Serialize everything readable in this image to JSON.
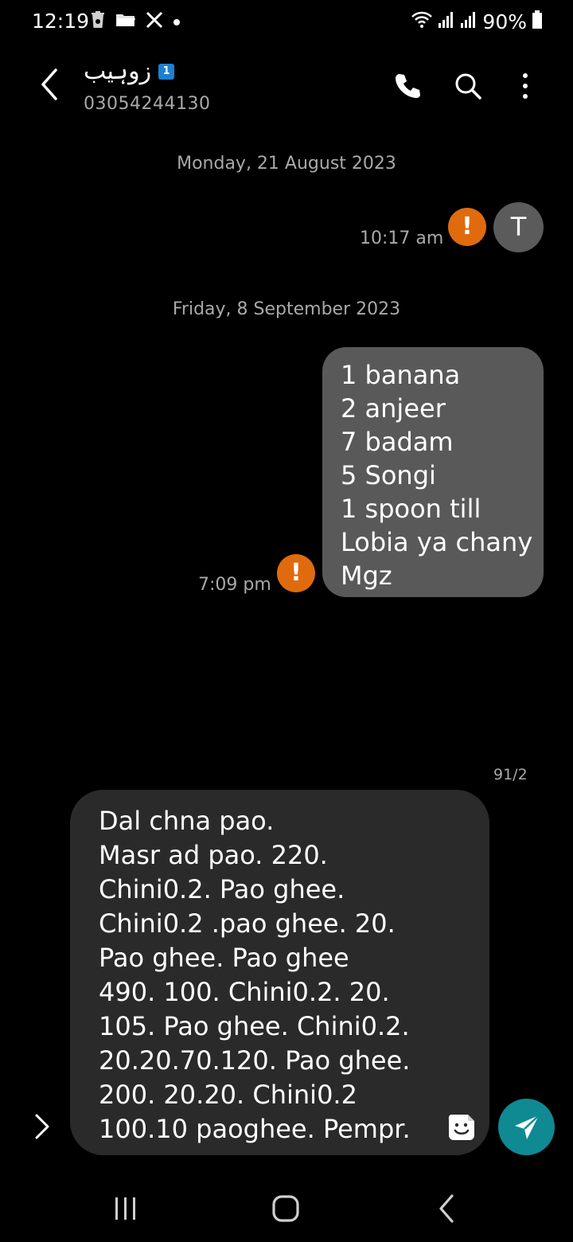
{
  "status_bar": {
    "time": "12:19",
    "notification_icons": [
      "recycle-bin-icon",
      "folder-icon",
      "x-logo-icon",
      "dot-icon"
    ],
    "battery": "90%"
  },
  "header": {
    "contact_name": "زوہیب",
    "sim_badge": "1",
    "contact_number": "03054244130"
  },
  "conversation": {
    "date_1": "Monday, 21 August 2023",
    "message_1": {
      "time": "10:17 am",
      "avatar_letter": "T",
      "status": "!"
    },
    "date_2": "Friday, 8 September 2023",
    "message_2": {
      "time": "7:09 pm",
      "status": "!",
      "lines": [
        "1 banana",
        "2 anjeer",
        "7 badam",
        "5 Songi",
        "1 spoon till",
        "Lobia ya chany",
        "Mgz"
      ]
    }
  },
  "composer": {
    "char_count": "91/2",
    "lines": [
      "Dal chna pao.",
      "Masr ad pao. 220.",
      "Chini0.2. Pao ghee.",
      "Chini0.2 .pao ghee. 20.",
      "Pao ghee. Pao ghee",
      "490. 100. Chini0.2. 20.",
      "105. Pao ghee. Chini0.2.",
      "20.20.70.120. Pao ghee.",
      "200. 20.20. Chini0.2",
      "100.10 paoghee. Pempr."
    ]
  },
  "colors": {
    "background": "#000000",
    "warning": "#e06b0e",
    "send": "#0f8a93",
    "bubble": "#595959",
    "composer": "#2a2a2a"
  }
}
